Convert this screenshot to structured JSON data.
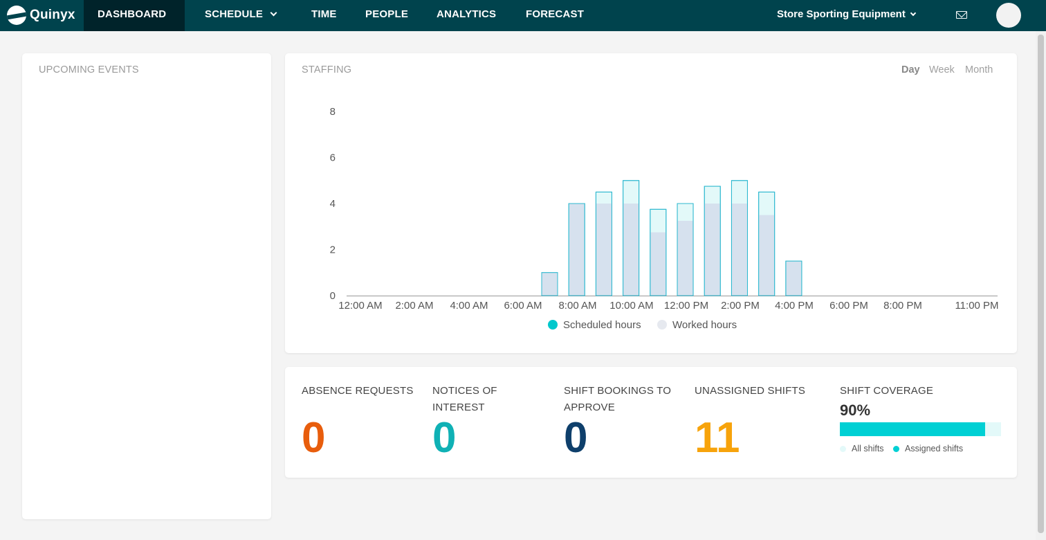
{
  "app": {
    "name": "Quinyx"
  },
  "nav": {
    "items": [
      {
        "label": "DASHBOARD",
        "active": true
      },
      {
        "label": "SCHEDULE",
        "has_dropdown": true
      },
      {
        "label": "TIME"
      },
      {
        "label": "PEOPLE"
      },
      {
        "label": "ANALYTICS"
      },
      {
        "label": "FORECAST"
      }
    ],
    "store": "Store Sporting Equipment",
    "icons": [
      "mail-icon",
      "avatar"
    ]
  },
  "upcoming_events": {
    "title": "UPCOMING EVENTS"
  },
  "staffing": {
    "title": "STAFFING",
    "ranges": [
      {
        "label": "Day",
        "active": true
      },
      {
        "label": "Week"
      },
      {
        "label": "Month"
      }
    ]
  },
  "chart_data": {
    "type": "bar",
    "title": "STAFFING",
    "categories": [
      "12:00 AM",
      "1:00 AM",
      "2:00 AM",
      "3:00 AM",
      "4:00 AM",
      "5:00 AM",
      "6:00 AM",
      "7:00 AM",
      "8:00 AM",
      "9:00 AM",
      "10:00 AM",
      "11:00 AM",
      "12:00 PM",
      "1:00 PM",
      "2:00 PM",
      "3:00 PM",
      "4:00 PM",
      "5:00 PM",
      "6:00 PM",
      "7:00 PM",
      "8:00 PM",
      "9:00 PM",
      "10:00 PM",
      "11:00 PM"
    ],
    "x_tick_labels": [
      "12:00 AM",
      "2:00 AM",
      "4:00 AM",
      "6:00 AM",
      "8:00 AM",
      "10:00 AM",
      "12:00 PM",
      "2:00 PM",
      "4:00 PM",
      "6:00 PM",
      "8:00 PM",
      "11:00 PM"
    ],
    "y_ticks": [
      0,
      2,
      4,
      6,
      8
    ],
    "ylim": [
      0,
      8
    ],
    "series": [
      {
        "name": "Scheduled hours",
        "color": "#00c8cc",
        "values": [
          0,
          0,
          0,
          0,
          0,
          0,
          0,
          1,
          4,
          4.5,
          5,
          3.75,
          4,
          4.75,
          5,
          4.5,
          1.5,
          0,
          0,
          0,
          0,
          0,
          0,
          0
        ]
      },
      {
        "name": "Worked hours",
        "color": "#d6e1ee",
        "values": [
          0,
          0,
          0,
          0,
          0,
          0,
          0,
          1,
          4,
          4,
          4,
          2.75,
          3.25,
          4,
          4,
          3.5,
          1.5,
          0,
          0,
          0,
          0,
          0,
          0,
          0
        ]
      }
    ],
    "legend_position": "bottom-center",
    "grid": false
  },
  "stats": [
    {
      "label": "ABSENCE REQUESTS",
      "value": "0",
      "color": "#e85d0c"
    },
    {
      "label": "NOTICES OF INTEREST",
      "value": "0",
      "color": "#0fb1b5"
    },
    {
      "label": "SHIFT BOOKINGS TO APPROVE",
      "value": "0",
      "color": "#0e3f6b"
    },
    {
      "label": "UNASSIGNED SHIFTS",
      "value": "11",
      "color": "#f7a30b"
    }
  ],
  "coverage": {
    "label": "SHIFT COVERAGE",
    "percent_text": "90%",
    "fraction": 0.9,
    "legend": [
      {
        "label": "All shifts",
        "color": "#e3f9f9"
      },
      {
        "label": "Assigned shifts",
        "color": "#00d0d4"
      }
    ]
  }
}
